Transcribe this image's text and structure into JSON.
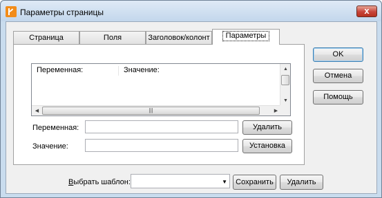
{
  "window": {
    "title": "Параметры страницы",
    "close_glyph": "x"
  },
  "tabs": [
    {
      "label": "Страница",
      "active": false
    },
    {
      "label": "Поля",
      "active": false
    },
    {
      "label": "Заголовок/колонт",
      "active": false
    },
    {
      "label": "Параметры",
      "active": true
    }
  ],
  "list": {
    "columns": [
      "Переменная:",
      "Значение:"
    ],
    "rows": []
  },
  "variable": {
    "label": "Переменная:",
    "value": "",
    "button": "Удалить"
  },
  "value": {
    "label": "Значение:",
    "value": "",
    "button": "Установка"
  },
  "side_buttons": {
    "ok": "OK",
    "cancel": "Отмена",
    "help": "Помощь"
  },
  "template": {
    "label_accel": "В",
    "label_rest": "ыбрать шаблон:",
    "selected": "",
    "save_button": "Сохранить",
    "delete_button": "Удалить"
  },
  "colors": {
    "frame": "#c9dcee",
    "close": "#c7443a",
    "default_button_border": "#3c7fb1"
  }
}
